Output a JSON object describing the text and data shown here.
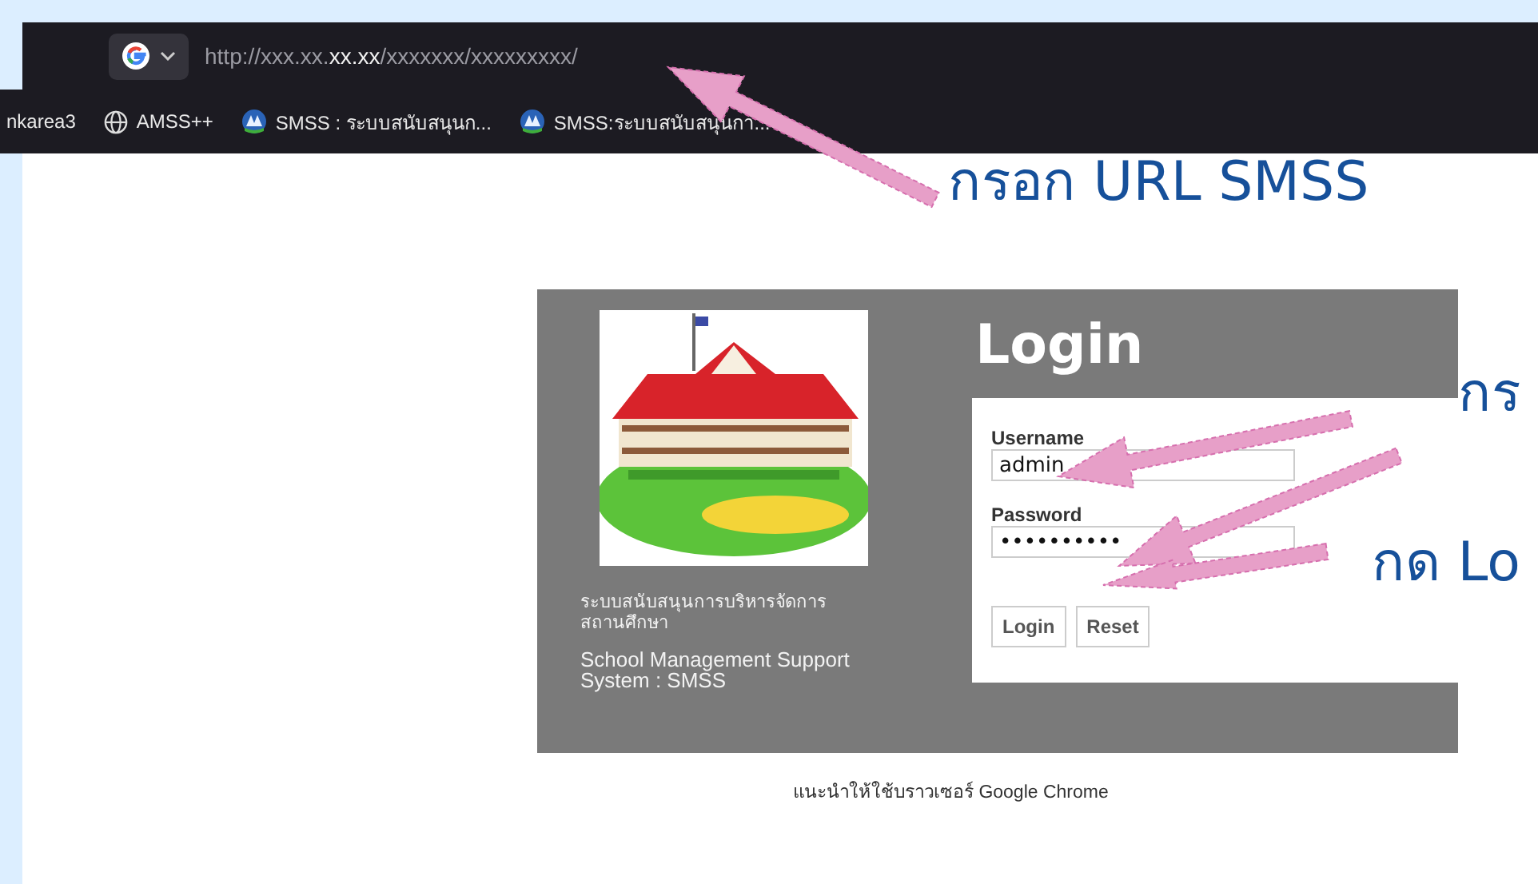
{
  "browser": {
    "url": "http://xxx.xx.**xx.xx**/xxxxxxx/xxxxxxxxx/",
    "bookmarks": [
      {
        "label": "nkarea3",
        "kind": "plain"
      },
      {
        "label": "AMSS++",
        "kind": "globe"
      },
      {
        "label": "SMSS : ระบบสนับสนุนก...",
        "kind": "logo"
      },
      {
        "label": "SMSS:ระบบสนับสนุนกา...",
        "kind": "logo"
      }
    ]
  },
  "login": {
    "title": "Login",
    "picture": {
      "kind": "picture"
    },
    "system_name_th": "ระบบสนับสนุนการบริหารจัดการสถานศึกษา",
    "system_name_en": "School Management Support System : SMSS",
    "username": {
      "label": "Username",
      "value": "admin"
    },
    "password": {
      "label": "Password",
      "value": "••••••••••"
    },
    "buttons": [
      "Login",
      "Reset"
    ]
  },
  "footer_note": "แนะนำให้ใช้บราวเซอร์ Google Chrome",
  "annotations": [
    "กรอก URL SMSS",
    "กร",
    "กด Lo"
  ]
}
